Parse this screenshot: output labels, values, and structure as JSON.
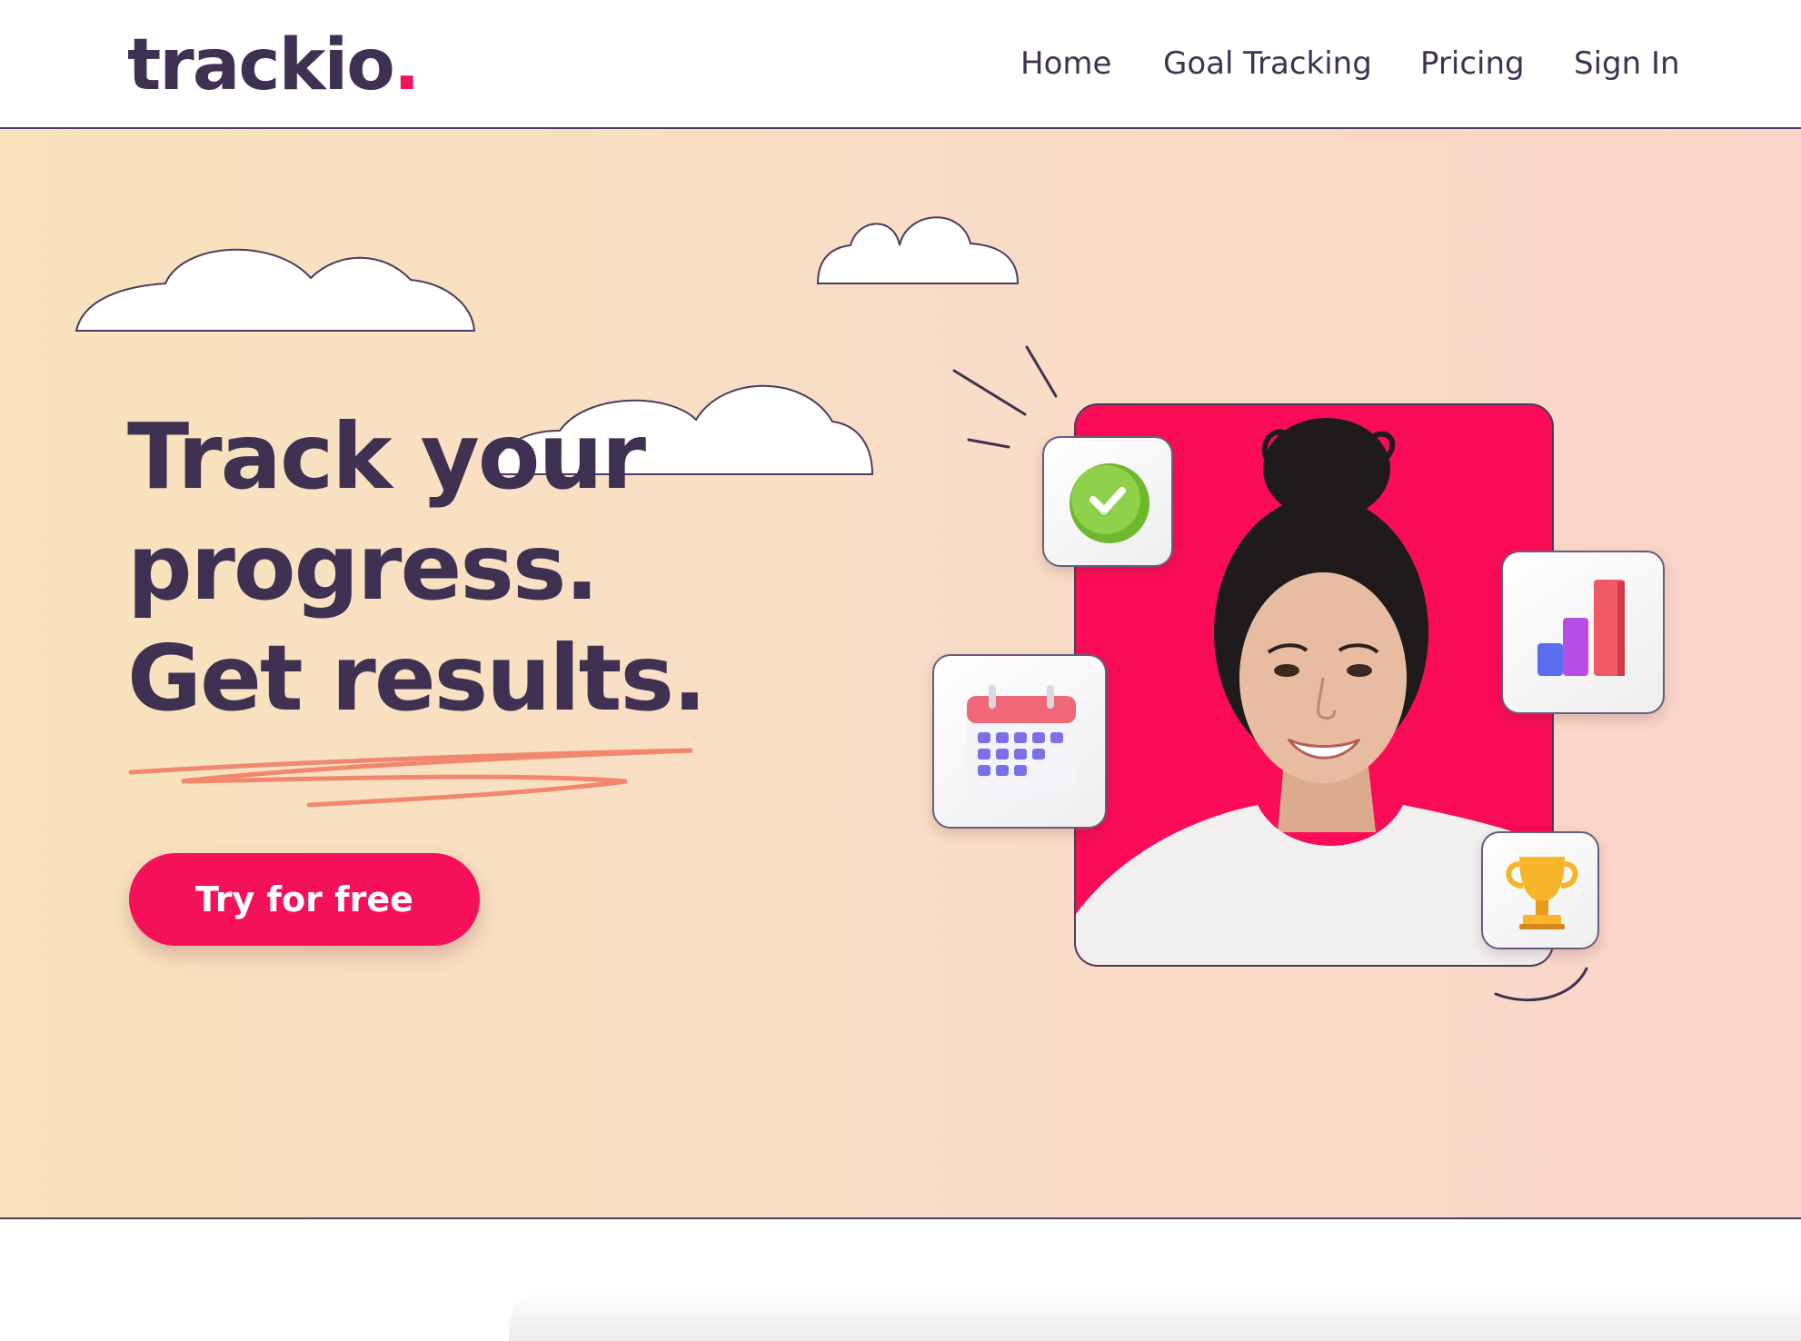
{
  "brand": {
    "name": "trackio",
    "dot": ".",
    "accent_color": "#f5105a",
    "text_color": "#3f3152"
  },
  "nav": {
    "home": "Home",
    "goal_tracking": "Goal Tracking",
    "pricing": "Pricing",
    "sign_in": "Sign In"
  },
  "hero": {
    "headline_line1": "Track your",
    "headline_line2": "progress.",
    "headline_line3": "Get results.",
    "cta_label": "Try for free",
    "background_colors": [
      "#f8e3bc",
      "#f9d4c8"
    ],
    "photo_card_color": "#fa0c56"
  },
  "feature_icons": [
    "checkmark-icon",
    "calendar-icon",
    "bar-chart-icon",
    "trophy-icon"
  ]
}
